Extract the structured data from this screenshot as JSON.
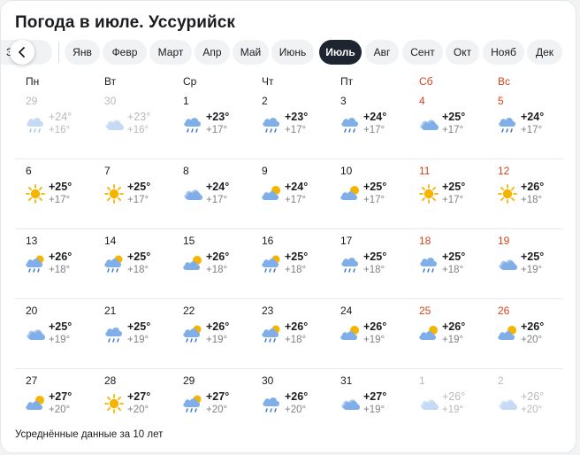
{
  "title": "Погода в июле. Уссурийск",
  "months": [
    {
      "label": "Зимой"
    },
    {
      "label": "Янв"
    },
    {
      "label": "Февр"
    },
    {
      "label": "Март"
    },
    {
      "label": "Апр"
    },
    {
      "label": "Май"
    },
    {
      "label": "Июнь"
    },
    {
      "label": "Июль",
      "active": true
    },
    {
      "label": "Авг"
    },
    {
      "label": "Сент"
    },
    {
      "label": "Окт"
    },
    {
      "label": "Нояб"
    },
    {
      "label": "Дек"
    }
  ],
  "prev_partial_label": "З    ей",
  "weekdays": [
    {
      "label": "Пн",
      "weekend": false
    },
    {
      "label": "Вт",
      "weekend": false
    },
    {
      "label": "Ср",
      "weekend": false
    },
    {
      "label": "Чт",
      "weekend": false
    },
    {
      "label": "Пт",
      "weekend": false
    },
    {
      "label": "Сб",
      "weekend": true
    },
    {
      "label": "Вс",
      "weekend": true
    }
  ],
  "weeks": [
    [
      {
        "date": "29",
        "tmax": "+24°",
        "tmin": "+16°",
        "icon": "cloud-rain-icon",
        "muted": true
      },
      {
        "date": "30",
        "tmax": "+23°",
        "tmin": "+16°",
        "icon": "cloud-icon",
        "muted": true
      },
      {
        "date": "1",
        "tmax": "+23°",
        "tmin": "+17°",
        "icon": "cloud-rain-icon"
      },
      {
        "date": "2",
        "tmax": "+23°",
        "tmin": "+17°",
        "icon": "cloud-rain-icon"
      },
      {
        "date": "3",
        "tmax": "+24°",
        "tmin": "+17°",
        "icon": "cloud-rain-icon"
      },
      {
        "date": "4",
        "tmax": "+25°",
        "tmin": "+17°",
        "icon": "cloud-icon"
      },
      {
        "date": "5",
        "tmax": "+24°",
        "tmin": "+17°",
        "icon": "cloud-rain-icon"
      }
    ],
    [
      {
        "date": "6",
        "tmax": "+25°",
        "tmin": "+17°",
        "icon": "sun-icon"
      },
      {
        "date": "7",
        "tmax": "+25°",
        "tmin": "+17°",
        "icon": "sun-icon"
      },
      {
        "date": "8",
        "tmax": "+24°",
        "tmin": "+17°",
        "icon": "cloud-icon"
      },
      {
        "date": "9",
        "tmax": "+24°",
        "tmin": "+17°",
        "icon": "partly-cloudy-icon"
      },
      {
        "date": "10",
        "tmax": "+25°",
        "tmin": "+17°",
        "icon": "partly-cloudy-icon"
      },
      {
        "date": "11",
        "tmax": "+25°",
        "tmin": "+17°",
        "icon": "sun-icon"
      },
      {
        "date": "12",
        "tmax": "+26°",
        "tmin": "+18°",
        "icon": "sun-icon"
      }
    ],
    [
      {
        "date": "13",
        "tmax": "+26°",
        "tmin": "+18°",
        "icon": "partly-cloudy-rain-icon"
      },
      {
        "date": "14",
        "tmax": "+25°",
        "tmin": "+18°",
        "icon": "partly-cloudy-rain-icon"
      },
      {
        "date": "15",
        "tmax": "+26°",
        "tmin": "+18°",
        "icon": "partly-cloudy-icon"
      },
      {
        "date": "16",
        "tmax": "+25°",
        "tmin": "+18°",
        "icon": "partly-cloudy-rain-icon"
      },
      {
        "date": "17",
        "tmax": "+25°",
        "tmin": "+18°",
        "icon": "cloud-rain-icon"
      },
      {
        "date": "18",
        "tmax": "+25°",
        "tmin": "+18°",
        "icon": "cloud-rain-icon"
      },
      {
        "date": "19",
        "tmax": "+25°",
        "tmin": "+19°",
        "icon": "cloud-icon"
      }
    ],
    [
      {
        "date": "20",
        "tmax": "+25°",
        "tmin": "+19°",
        "icon": "cloud-icon"
      },
      {
        "date": "21",
        "tmax": "+25°",
        "tmin": "+19°",
        "icon": "cloud-rain-icon"
      },
      {
        "date": "22",
        "tmax": "+26°",
        "tmin": "+19°",
        "icon": "partly-cloudy-rain-icon"
      },
      {
        "date": "23",
        "tmax": "+26°",
        "tmin": "+18°",
        "icon": "partly-cloudy-rain-icon"
      },
      {
        "date": "24",
        "tmax": "+26°",
        "tmin": "+19°",
        "icon": "partly-cloudy-icon"
      },
      {
        "date": "25",
        "tmax": "+26°",
        "tmin": "+19°",
        "icon": "partly-cloudy-icon"
      },
      {
        "date": "26",
        "tmax": "+26°",
        "tmin": "+20°",
        "icon": "partly-cloudy-icon"
      }
    ],
    [
      {
        "date": "27",
        "tmax": "+27°",
        "tmin": "+20°",
        "icon": "partly-cloudy-icon"
      },
      {
        "date": "28",
        "tmax": "+27°",
        "tmin": "+20°",
        "icon": "sun-icon"
      },
      {
        "date": "29",
        "tmax": "+27°",
        "tmin": "+20°",
        "icon": "partly-cloudy-rain-icon"
      },
      {
        "date": "30",
        "tmax": "+26°",
        "tmin": "+20°",
        "icon": "cloud-rain-icon"
      },
      {
        "date": "31",
        "tmax": "+27°",
        "tmin": "+19°",
        "icon": "cloud-icon"
      },
      {
        "date": "1",
        "tmax": "+26°",
        "tmin": "+19°",
        "icon": "cloud-icon",
        "muted": true
      },
      {
        "date": "2",
        "tmax": "+26°",
        "tmin": "+20°",
        "icon": "cloud-icon",
        "muted": true
      }
    ]
  ],
  "footnote": "Усреднённые данные за 10 лет",
  "colors": {
    "accent_dark": "#1e2530",
    "weekend": "#d8431a",
    "cloud": "#7faee8",
    "sun": "#f5b400",
    "rain": "#3d78d8"
  }
}
